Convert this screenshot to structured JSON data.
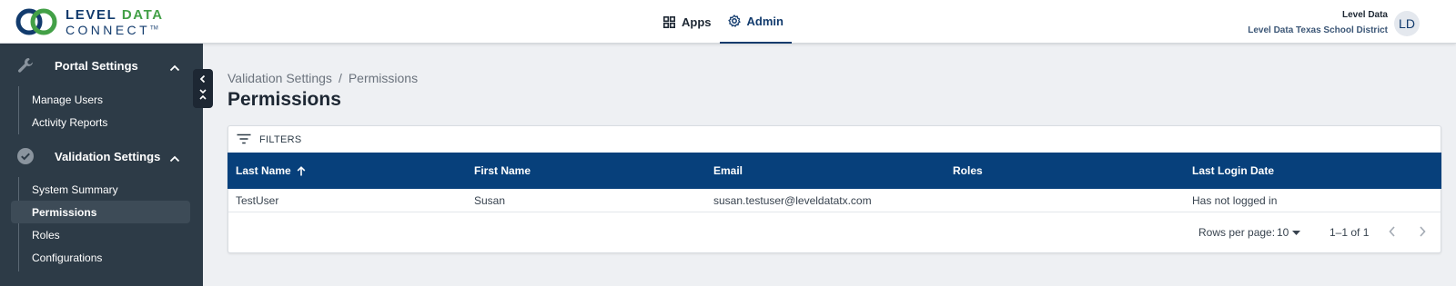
{
  "brand": {
    "line1a": "LEVEL",
    "line1b": "DATA",
    "line2": "CONNECT",
    "tm": "TM"
  },
  "topnav": {
    "apps": "Apps",
    "admin": "Admin"
  },
  "user": {
    "name": "Level Data",
    "district": "Level Data Texas School District",
    "initials": "LD"
  },
  "sidebar": {
    "groups": [
      {
        "label": "Portal Settings",
        "icon": "wrench-icon",
        "items": [
          "Manage Users",
          "Activity Reports"
        ]
      },
      {
        "label": "Validation Settings",
        "icon": "check-circle-icon",
        "items": [
          "System Summary",
          "Permissions",
          "Roles",
          "Configurations"
        ]
      }
    ],
    "active_item": "Permissions"
  },
  "breadcrumb": {
    "parent": "Validation Settings",
    "separator": "/",
    "current": "Permissions"
  },
  "page_title": "Permissions",
  "filters_label": "FILTERS",
  "table": {
    "columns": [
      "Last Name",
      "First Name",
      "Email",
      "Roles",
      "Last Login Date"
    ],
    "sort_column": "Last Name",
    "rows": [
      {
        "last_name": "TestUser",
        "first_name": "Susan",
        "email": "susan.testuser@leveldatatx.com",
        "roles": "",
        "last_login": "Has not logged in"
      }
    ]
  },
  "pagination": {
    "rows_per_page_label": "Rows per page:",
    "rows_per_page": "10",
    "range": "1–1 of 1"
  },
  "colors": {
    "sidebar_bg": "#2d3b47",
    "table_header": "#07407b",
    "brand_blue": "#123b6d",
    "brand_green": "#43a047"
  }
}
